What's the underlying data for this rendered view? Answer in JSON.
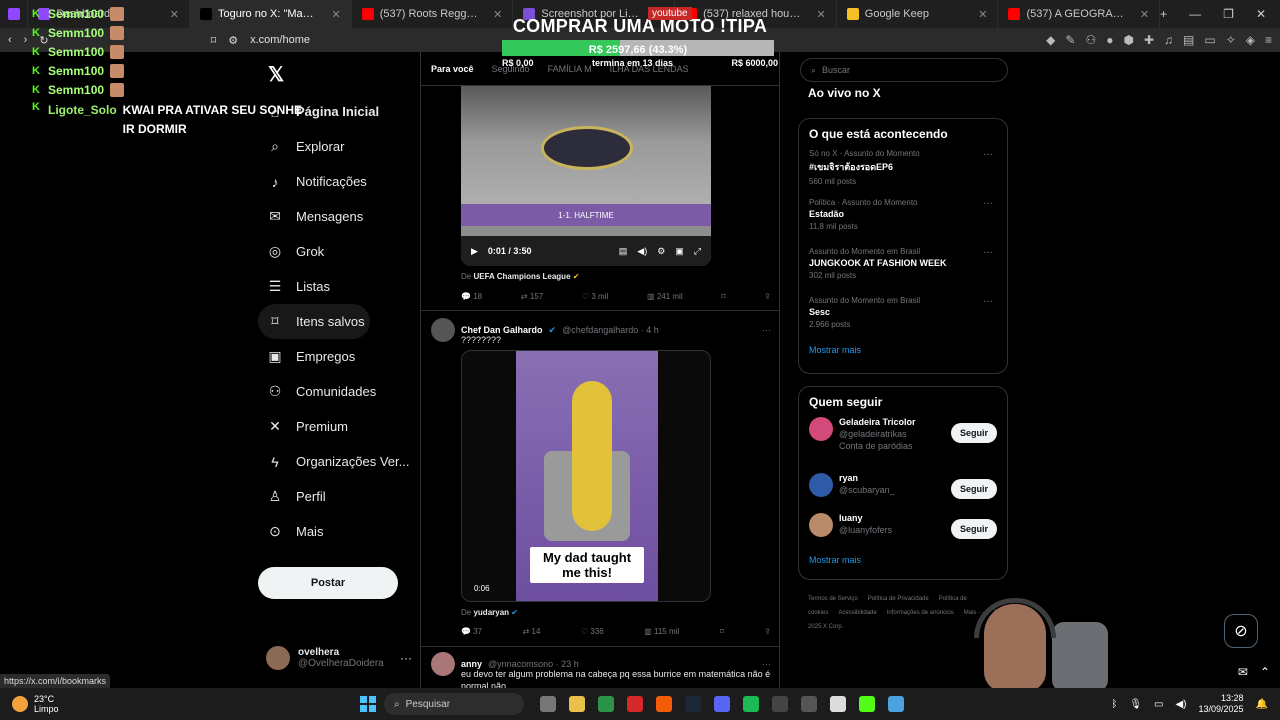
{
  "browser": {
    "tabs": [
      {
        "title": "Dashboard",
        "color": "#9146ff"
      },
      {
        "title": "Toguro no X: \"Mansão marombi...",
        "color": "#000000"
      },
      {
        "title": "(537) Roots Reggae (1973) [Unre...",
        "color": "#ff0000"
      },
      {
        "title": "Screenshot por Lightshot",
        "color": "#7b4fd6"
      },
      {
        "title": "(537) relaxed house mix to chain...",
        "color": "#ff0000"
      },
      {
        "title": "Google Keep",
        "color": "#f6bf26"
      },
      {
        "title": "(537) A GEOGRAFIA DE CADA ES...",
        "color": "#ff0000"
      }
    ],
    "url": "x.com/home",
    "status_url": "https://x.com/i/bookmarks"
  },
  "overlay": {
    "chat": [
      {
        "name": "Semm100"
      },
      {
        "name": "Semm100"
      },
      {
        "name": "Semm100"
      },
      {
        "name": "Semm100"
      },
      {
        "name": "Semm100"
      }
    ],
    "chat_last": {
      "name": "Ligote_Solo",
      "message": "KWAI PRA ATIVAR SEU SONHE IR DORMIR"
    },
    "youtube_tag": "youtube",
    "donation": {
      "title": "COMPRAR UMA MOTO !TIPA",
      "progress_text": "R$ 2597,66 (43.3%)",
      "progress_fraction": 0.433,
      "min": "R$ 0,00",
      "deadline": "termina em 13 dias",
      "max": "R$ 6000,00",
      "fill_color": "#34c759"
    }
  },
  "nav": {
    "items": [
      {
        "label": "Página Inicial",
        "icon": "⌂"
      },
      {
        "label": "Explorar",
        "icon": "⌕"
      },
      {
        "label": "Notificações",
        "icon": "♪"
      },
      {
        "label": "Mensagens",
        "icon": "✉"
      },
      {
        "label": "Grok",
        "icon": "◎"
      },
      {
        "label": "Listas",
        "icon": "☰"
      },
      {
        "label": "Itens salvos",
        "icon": "⌑"
      },
      {
        "label": "Empregos",
        "icon": "▣"
      },
      {
        "label": "Comunidades",
        "icon": "⚇"
      },
      {
        "label": "Premium",
        "icon": "✕"
      },
      {
        "label": "Organizações Ver...",
        "icon": "ϟ"
      },
      {
        "label": "Perfil",
        "icon": "♙"
      },
      {
        "label": "Mais",
        "icon": "⊙"
      }
    ],
    "post_button": "Postar",
    "profile": {
      "name": "ovelhera",
      "handle": "@OvelheraDoidera"
    }
  },
  "feed": {
    "tabs": [
      "Para você",
      "Seguindo",
      "FAMÍLIA M",
      "ILHA DAS LENDAS"
    ],
    "tweet1": {
      "video_caption": "1-1. HALFTIME",
      "time": "0:01 / 3:50",
      "from_label": "De",
      "from": "UEFA Champions League",
      "replies": "18",
      "retweets": "157",
      "likes": "3 mil",
      "views": "241 mil"
    },
    "tweet2": {
      "name": "Chef Dan Galhardo",
      "handle": "@chefdangalhardo · 4 h",
      "text": "????????",
      "video_caption": "My dad taught me this!",
      "video_time": "0:06",
      "from_label": "De",
      "from": "yudaryan",
      "replies": "37",
      "retweets": "14",
      "likes": "336",
      "views": "115 mil"
    },
    "tweet3": {
      "name": "anny",
      "handle": "@ynnacomsono · 23 h",
      "text": "eu devo ter algum problema na cabeça pq essa burrice em matemática não é normal não"
    }
  },
  "right": {
    "search_placeholder": "Buscar",
    "live": "Ao vivo no X",
    "trends_title": "O que está acontecendo",
    "trends": [
      {
        "context": "Só no X · Assunto do Momento",
        "title": "#เขมจิราต้องรอดEP6",
        "count": "560 mil posts"
      },
      {
        "context": "Política · Assunto do Momento",
        "title": "Estadão",
        "count": "11,8 mil posts"
      },
      {
        "context": "Assunto do Momento em Brasil",
        "title": "JUNGKOOK AT FASHION WEEK",
        "count": "302 mil posts"
      },
      {
        "context": "Assunto do Momento em Brasil",
        "title": "Sesc",
        "count": "2.966 posts"
      }
    ],
    "show_more": "Mostrar mais",
    "follow_title": "Quem seguir",
    "follow": [
      {
        "name": "Geladeira Tricolor",
        "handle": "@geladeiratrikas",
        "extra": "Conta de paródias",
        "button": "Seguir"
      },
      {
        "name": "ryan",
        "handle": "@scubaryan_",
        "extra": "",
        "button": "Seguir"
      },
      {
        "name": "luany",
        "handle": "@luanyfofers",
        "extra": "",
        "button": "Seguir"
      }
    ],
    "show_more_2": "Mostrar mais",
    "footer": [
      "Termos de Serviço",
      "Política de Privacidade",
      "Política de cookies",
      "Acessibilidade",
      "Informações de anúncios",
      "Mais ···",
      "© 2025 X Corp."
    ]
  },
  "taskbar": {
    "temp": "23°C",
    "weather": "Limpo",
    "search": "Pesquisar",
    "time": "13:28",
    "date": "13/09/2025"
  }
}
